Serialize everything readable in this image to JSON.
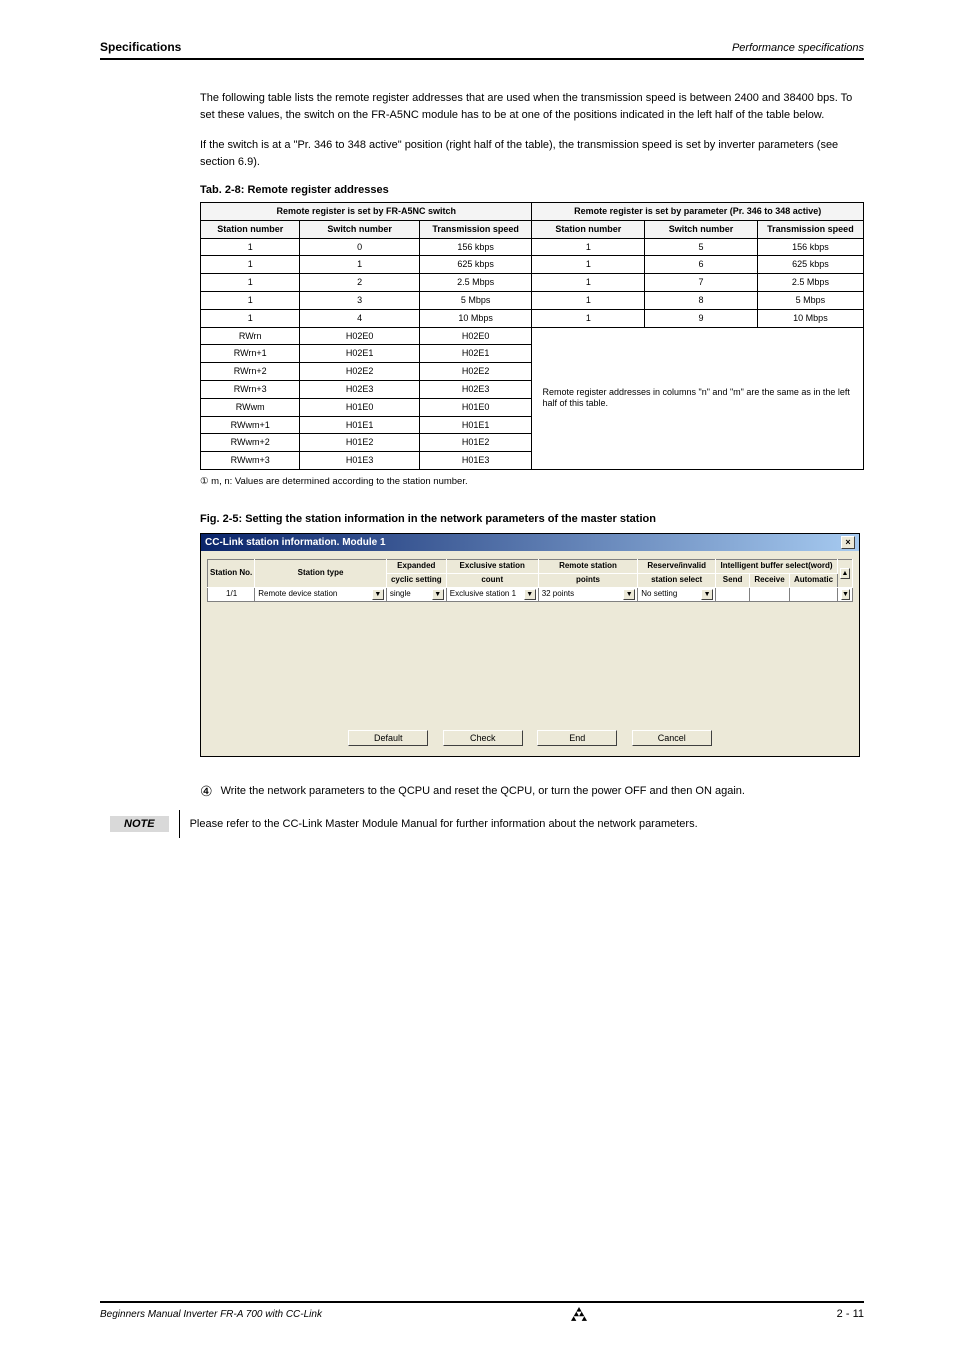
{
  "header": {
    "left": "Specifications",
    "right": "Performance specifications"
  },
  "intro": {
    "p1": "The following table lists the remote register addresses that are used when the transmission speed is between 2400 and 38400 bps. To set these values, the switch on the FR-A5NC module has to be at one of the positions indicated in the left half of the table below.",
    "p2": "If the switch is at a \"Pr. 346 to 348 active\" position (right half of the table), the transmission speed is set by inverter parameters (see section 6.9)."
  },
  "table": {
    "caption": "Tab. 2-8: Remote register addresses",
    "header_left": "Remote register is set by FR-A5NC switch",
    "header_right": "Remote register is set by parameter (Pr. 346 to 348 active)",
    "sub": {
      "c1": "Station number",
      "c2": "Switch number",
      "c3": "Transmission speed",
      "c4": "Station number",
      "c5": "Switch number",
      "c6": "Transmission speed"
    },
    "rows": [
      {
        "c1": "1",
        "c2": "0",
        "c3": "156 kbps",
        "c4": "1",
        "c5": "5",
        "c6": "156 kbps"
      },
      {
        "c1": "1",
        "c2": "1",
        "c3": "625 kbps",
        "c4": "1",
        "c5": "6",
        "c6": "625 kbps"
      },
      {
        "c1": "1",
        "c2": "2",
        "c3": "2.5 Mbps",
        "c4": "1",
        "c5": "7",
        "c6": "2.5 Mbps"
      },
      {
        "c1": "1",
        "c2": "3",
        "c3": "5 Mbps",
        "c4": "1",
        "c5": "8",
        "c6": "5 Mbps"
      },
      {
        "c1": "1",
        "c2": "4",
        "c3": "10 Mbps",
        "c4": "1",
        "c5": "9",
        "c6": "10 Mbps"
      }
    ],
    "rows2": [
      {
        "c1": "RWrn",
        "c2": "H02E0",
        "c3": "H02E0"
      },
      {
        "c1": "RWrn+1",
        "c2": "H02E1",
        "c3": "H02E1"
      },
      {
        "c1": "RWrn+2",
        "c2": "H02E2",
        "c3": "H02E2"
      },
      {
        "c1": "RWrn+3",
        "c2": "H02E3",
        "c3": "H02E3"
      },
      {
        "c1": "RWwm",
        "c2": "H01E0",
        "c3": "H01E0"
      },
      {
        "c1": "RWwm+1",
        "c2": "H01E1",
        "c3": "H01E1"
      },
      {
        "c1": "RWwm+2",
        "c2": "H01E2",
        "c3": "H01E2"
      },
      {
        "c1": "RWwm+3",
        "c2": "H01E3",
        "c3": "H01E3"
      }
    ],
    "merged_note": "Remote register addresses in columns \"n\" and \"m\" are the same as in the left half of this table.",
    "footnote": "① m, n: Values are determined according to the station number."
  },
  "figure": {
    "caption": "Fig. 2-5: Setting the station information in the network parameters of the master station",
    "title": "CC-Link station information. Module 1",
    "cols": {
      "stno": "Station No.",
      "sttype": "Station type",
      "exp1": "Expanded",
      "exp2": "cyclic setting",
      "exc1": "Exclusive station",
      "exc2": "count",
      "rem1": "Remote station",
      "rem2": "points",
      "res1": "Reserve/invalid",
      "res2": "station select",
      "int": "Intelligent buffer select(word)",
      "send": "Send",
      "recv": "Receive",
      "auto": "Automatic"
    },
    "row": {
      "stno": "1/1",
      "sttype": "Remote device station",
      "exp": "single",
      "exc": "Exclusive station 1",
      "rem": "32 points",
      "res": "No setting"
    },
    "buttons": {
      "default": "Default",
      "check": "Check",
      "end": "End",
      "cancel": "Cancel"
    }
  },
  "step": {
    "num": "④",
    "text": "Write the network parameters to the QCPU and reset the QCPU, or turn the power OFF and then ON again."
  },
  "note": {
    "label": "NOTE",
    "text": "Please refer to the CC-Link Master Module Manual for further information about the network parameters."
  },
  "footer": {
    "left": "Beginners Manual Inverter FR-A 700 with CC-Link",
    "page": "2 - 11"
  }
}
